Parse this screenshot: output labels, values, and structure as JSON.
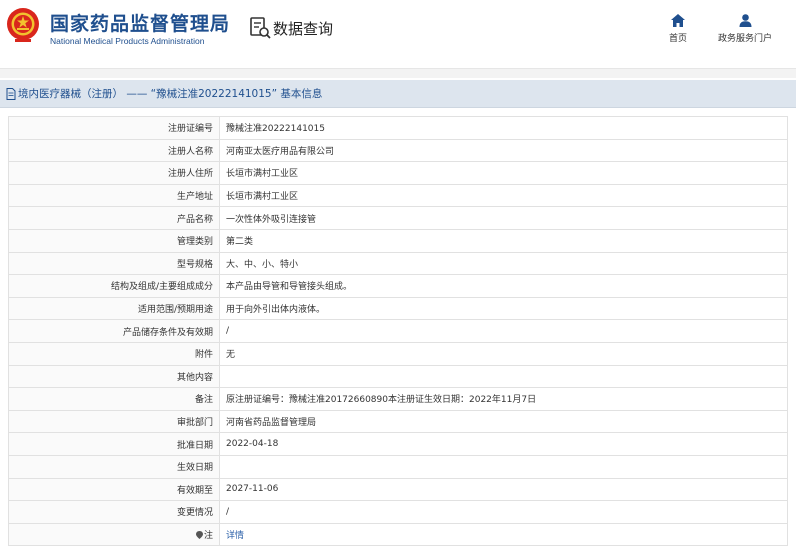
{
  "header": {
    "site_name_cn": "国家药品监督管理局",
    "site_name_en": "National Medical Products Administration",
    "query_title": "数据查询",
    "nav": [
      {
        "label": "首页",
        "icon": "home-icon"
      },
      {
        "label": "政务服务门户",
        "icon": "user-icon"
      }
    ],
    "brand_color": "#1f4f8e",
    "emblem_color": "#d9261c"
  },
  "page_title": "境内医疗器械（注册） —— “豫械注准20222141015” 基本信息",
  "rows": [
    {
      "label": "注册证编号",
      "value": "豫械注准20222141015"
    },
    {
      "label": "注册人名称",
      "value": "河南亚太医疗用品有限公司"
    },
    {
      "label": "注册人住所",
      "value": "长垣市满村工业区"
    },
    {
      "label": "生产地址",
      "value": "长垣市满村工业区"
    },
    {
      "label": "产品名称",
      "value": "一次性体外吸引连接管"
    },
    {
      "label": "管理类别",
      "value": "第二类"
    },
    {
      "label": "型号规格",
      "value": "大、中、小、特小"
    },
    {
      "label": "结构及组成/主要组成成分",
      "value": "本产品由导管和导管接头组成。"
    },
    {
      "label": "适用范围/预期用途",
      "value": "用于向外引出体内液体。"
    },
    {
      "label": "产品储存条件及有效期",
      "value": "/"
    },
    {
      "label": "附件",
      "value": "无"
    },
    {
      "label": "其他内容",
      "value": ""
    },
    {
      "label": "备注",
      "value": "原注册证编号：豫械注准20172660890本注册证生效日期：2022年11月7日"
    },
    {
      "label": "审批部门",
      "value": "河南省药品监督管理局"
    },
    {
      "label": "批准日期",
      "value": "2022-04-18"
    },
    {
      "label": "生效日期",
      "value": ""
    },
    {
      "label": "有效期至",
      "value": "2027-11-06"
    },
    {
      "label": "变更情况",
      "value": "/"
    },
    {
      "label": "注",
      "value": "详情",
      "link": true,
      "icon": "note-icon"
    }
  ]
}
